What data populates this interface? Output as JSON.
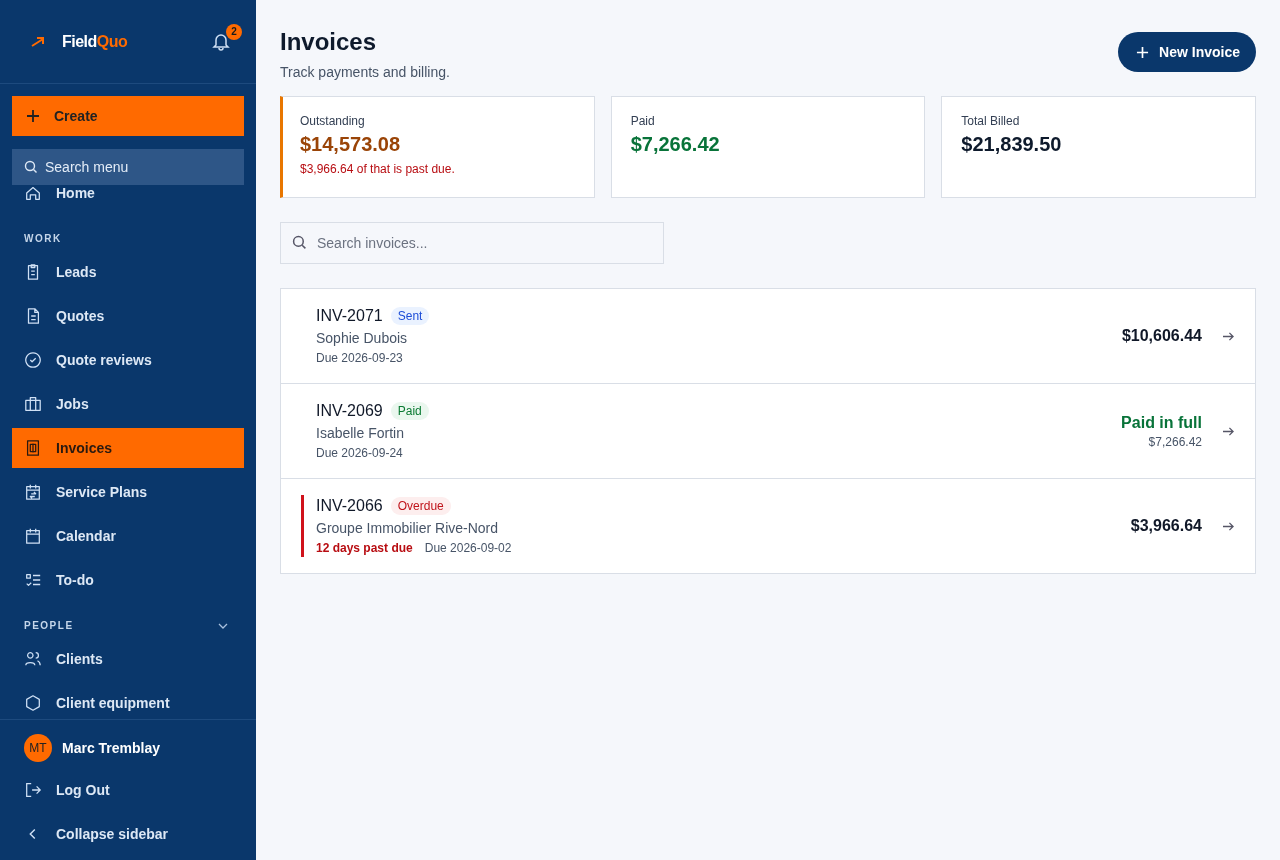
{
  "brand": {
    "name_a": "Field",
    "name_b": "Quo"
  },
  "notifications": {
    "count": "2"
  },
  "create_button": "Create",
  "menu_search": {
    "placeholder": "Search menu"
  },
  "nav": [
    {
      "kind": "item",
      "label": "Home",
      "selected": false
    },
    {
      "kind": "heading",
      "label": "WORK"
    },
    {
      "kind": "item",
      "label": "Leads",
      "selected": false
    },
    {
      "kind": "item",
      "label": "Quotes",
      "selected": false
    },
    {
      "kind": "item",
      "label": "Quote reviews",
      "selected": false
    },
    {
      "kind": "item",
      "label": "Jobs",
      "selected": false
    },
    {
      "kind": "item",
      "label": "Invoices",
      "selected": true
    },
    {
      "kind": "item",
      "label": "Service Plans",
      "selected": false
    },
    {
      "kind": "item",
      "label": "Calendar",
      "selected": false
    },
    {
      "kind": "item",
      "label": "To-do",
      "selected": false
    },
    {
      "kind": "heading",
      "label": "PEOPLE",
      "expanded": true
    },
    {
      "kind": "item",
      "label": "Clients",
      "selected": false
    },
    {
      "kind": "item",
      "label": "Client equipment",
      "selected": false
    }
  ],
  "user": {
    "initials": "MT",
    "name": "Marc Tremblay"
  },
  "logout": "Log Out",
  "collapse": "Collapse sidebar",
  "page": {
    "title": "Invoices",
    "subtitle": "Track payments and billing.",
    "new_button": "New Invoice"
  },
  "stats": [
    {
      "kind": "warning",
      "label": "Outstanding",
      "value": "$14,573.08",
      "note": "$3,966.64 of that is past due."
    },
    {
      "kind": "good",
      "label": "Paid",
      "value": "$7,266.42"
    },
    {
      "kind": "plain",
      "label": "Total Billed",
      "value": "$21,839.50"
    }
  ],
  "invoice_search": {
    "placeholder": "Search invoices..."
  },
  "invoices": [
    {
      "number": "INV-2071",
      "status": {
        "kind": "sent",
        "label": "Sent"
      },
      "client": "Sophie Dubois",
      "due": "Due 2026-09-23",
      "amount": "$10,606.44"
    },
    {
      "number": "INV-2069",
      "status": {
        "kind": "paid",
        "label": "Paid"
      },
      "client": "Isabelle Fortin",
      "due": "Due 2026-09-24",
      "amount": "Paid in full",
      "paid_amount": "$7,266.42"
    },
    {
      "number": "INV-2066",
      "status": {
        "kind": "overdue",
        "label": "Overdue"
      },
      "client": "Groupe Immobilier Rive-Nord",
      "past_due": "12 days past due",
      "due": "Due 2026-09-02",
      "amount": "$3,966.64"
    }
  ]
}
